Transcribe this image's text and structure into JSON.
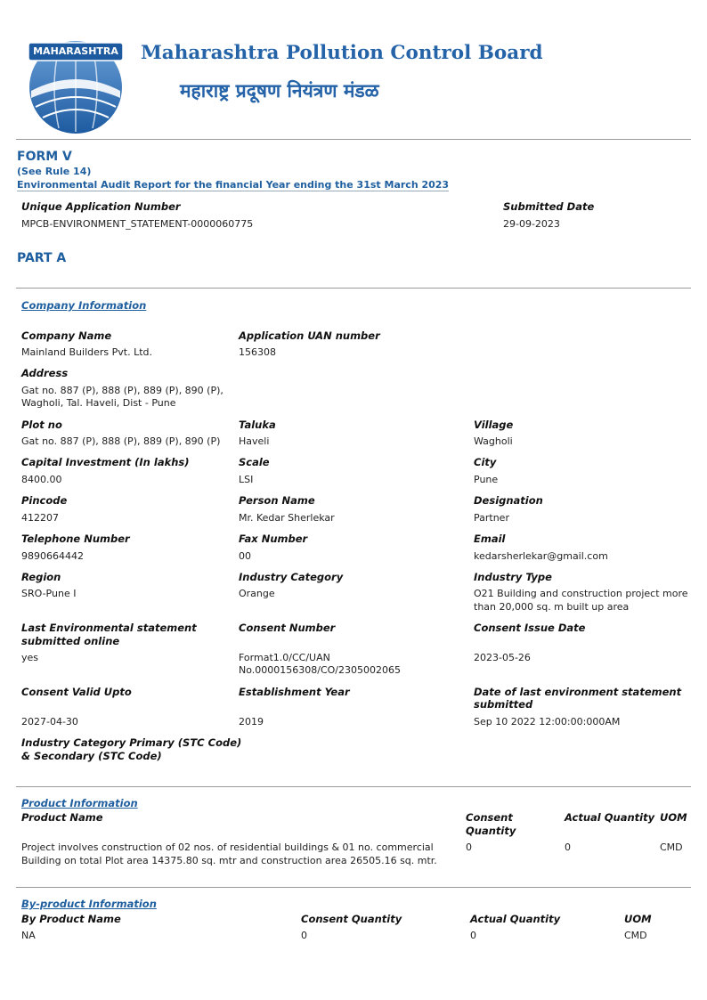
{
  "header": {
    "logo_text": "MAHARASHTRA",
    "org_name_en": "Maharashtra Pollution Control Board",
    "org_name_mr": "महाराष्ट्र प्रदूषण नियंत्रण मंडळ",
    "colors": {
      "brand_blue": "#2563a8",
      "heading_blue": "#1f5f9f"
    }
  },
  "form": {
    "title": "FORM V",
    "rule": "(See Rule 14)",
    "subtitle": "Environmental Audit Report for the financial Year ending the 31st March 2023",
    "uan_label": "Unique Application Number",
    "uan_value": "MPCB-ENVIRONMENT_STATEMENT-0000060775",
    "submitted_label": "Submitted Date",
    "submitted_value": "29-09-2023",
    "part": "PART A"
  },
  "company": {
    "section_title": "Company Information",
    "company_name_label": "Company Name",
    "company_name": "Mainland Builders Pvt. Ltd.",
    "app_uan_label": "Application UAN number",
    "app_uan": "156308",
    "address_label": "Address",
    "address_line1": "Gat no. 887 (P), 888 (P), 889 (P), 890 (P),",
    "address_line2": "Wagholi, Tal. Haveli, Dist - Pune",
    "plot_label": "Plot no",
    "plot": "Gat no. 887 (P), 888 (P), 889 (P), 890 (P)",
    "taluka_label": "Taluka",
    "taluka": "Haveli",
    "village_label": "Village",
    "village": "Wagholi",
    "capital_label": "Capital Investment (In lakhs)",
    "capital": "8400.00",
    "scale_label": "Scale",
    "scale": "LSI",
    "city_label": "City",
    "city": "Pune",
    "pincode_label": "Pincode",
    "pincode": "412207",
    "person_label": "Person Name",
    "person": "Mr. Kedar Sherlekar",
    "designation_label": "Designation",
    "designation": "Partner",
    "phone_label": "Telephone Number",
    "phone": "9890664442",
    "fax_label": "Fax Number",
    "fax": "00",
    "email_label": "Email",
    "email": "kedarsherlekar@gmail.com",
    "region_label": "Region",
    "region": "SRO-Pune I",
    "ind_cat_label": "Industry Category",
    "ind_cat": "Orange",
    "ind_type_label": "Industry Type",
    "ind_type_line1": "O21 Building and construction project more",
    "ind_type_line2": "than 20,000 sq. m built up area",
    "last_env_label_line1": "Last Environmental statement",
    "last_env_label_line2": "submitted online",
    "last_env": "yes",
    "consent_no_label": "Consent Number",
    "consent_no_line1": "Format1.0/CC/UAN",
    "consent_no_line2": "No.0000156308/CO/2305002065",
    "consent_issue_label": "Consent Issue Date",
    "consent_issue": "2023-05-26",
    "valid_label": "Consent Valid Upto",
    "valid": "2027-04-30",
    "est_label": "Establishment Year",
    "est": "2019",
    "last_date_label_line1": "Date of last environment statement",
    "last_date_label_line2": "submitted",
    "last_date": "Sep 10 2022 12:00:00:000AM",
    "stc_label_line1": "Industry Category Primary (STC Code)",
    "stc_label_line2": "& Secondary (STC Code)"
  },
  "product": {
    "section_title": "Product Information",
    "col_name": "Product Name",
    "col_consent_line1": "Consent",
    "col_consent_line2": "Quantity",
    "col_actual": "Actual Quantity",
    "col_uom": "UOM",
    "rows": [
      {
        "name_line1": "Project involves construction of 02 nos. of residential buildings & 01 no. commercial",
        "name_line2": "Building on total Plot area 14375.80 sq. mtr and construction area 26505.16 sq. mtr.",
        "consent": "0",
        "actual": "0",
        "uom": "CMD"
      }
    ]
  },
  "byproduct": {
    "section_title": "By-product Information",
    "col_name": "By Product Name",
    "col_consent": "Consent Quantity",
    "col_actual": "Actual Quantity",
    "col_uom": "UOM",
    "rows": [
      {
        "name": "NA",
        "consent": "0",
        "actual": "0",
        "uom": "CMD"
      }
    ]
  }
}
